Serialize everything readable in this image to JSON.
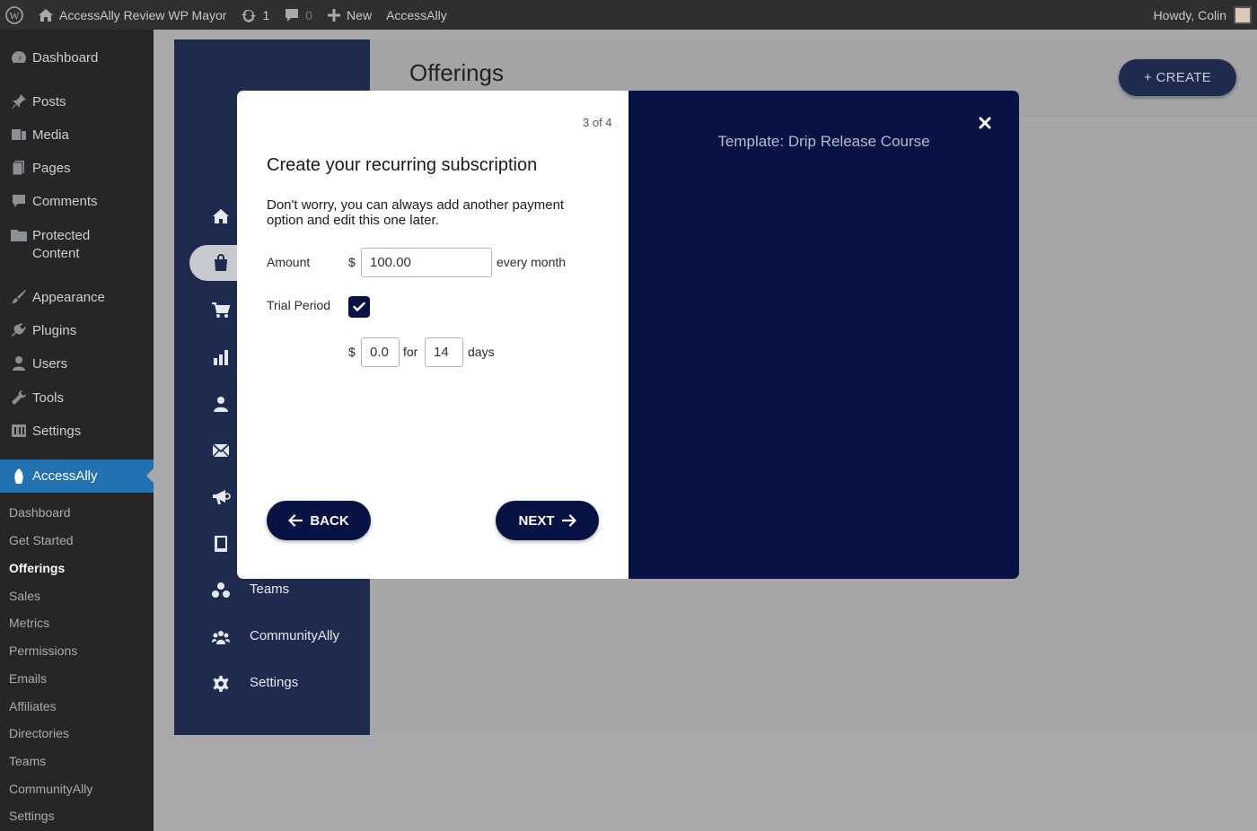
{
  "adminbar": {
    "site_name": "AccessAlly Review WP Mayor",
    "updates_count": "1",
    "comments_count": "0",
    "new_label": "New",
    "plugin_label": "AccessAlly",
    "howdy": "Howdy, Colin"
  },
  "wp_menu": {
    "items": [
      {
        "label": "Dashboard",
        "icon": "dashboard-icon"
      },
      {
        "label": "Posts",
        "icon": "pin-icon"
      },
      {
        "label": "Media",
        "icon": "media-icon"
      },
      {
        "label": "Pages",
        "icon": "pages-icon"
      },
      {
        "label": "Comments",
        "icon": "comment-icon"
      },
      {
        "label": "Protected Content",
        "icon": "folder-icon"
      },
      {
        "label": "Appearance",
        "icon": "brush-icon"
      },
      {
        "label": "Plugins",
        "icon": "plugin-icon"
      },
      {
        "label": "Users",
        "icon": "user-icon"
      },
      {
        "label": "Tools",
        "icon": "wrench-icon"
      },
      {
        "label": "Settings",
        "icon": "settings-icon"
      },
      {
        "label": "AccessAlly",
        "icon": "accessally-icon"
      }
    ],
    "submenu": [
      "Dashboard",
      "Get Started",
      "Offerings",
      "Sales",
      "Metrics",
      "Permissions",
      "Emails",
      "Affiliates",
      "Directories",
      "Teams",
      "CommunityAlly",
      "Settings"
    ],
    "current_submenu": "Offerings"
  },
  "aa_nav": {
    "items": [
      {
        "icon": "home-icon"
      },
      {
        "icon": "shop-bag-icon"
      },
      {
        "icon": "cart-icon"
      },
      {
        "icon": "bar-chart-icon"
      },
      {
        "icon": "person-icon"
      },
      {
        "icon": "envelope-icon"
      },
      {
        "icon": "megaphone-icon"
      },
      {
        "icon": "book-icon"
      },
      {
        "icon": "teams-icon",
        "label": "Teams"
      },
      {
        "icon": "community-icon",
        "label": "CommunityAlly"
      },
      {
        "icon": "gear-icon",
        "label": "Settings"
      }
    ]
  },
  "page": {
    "title": "Offerings",
    "create_label": "+ CREATE"
  },
  "modal": {
    "step": "3 of 4",
    "heading": "Create your recurring subscription",
    "description": "Don't worry, you can always add another payment option and edit this one later.",
    "amount_label": "Amount",
    "currency": "$",
    "amount_value": "100.00",
    "frequency": "every month",
    "trial_label": "Trial Period",
    "trial_checked": true,
    "trial_price": "0.0",
    "trial_for": "for",
    "trial_days_value": "14",
    "trial_days_unit": "days",
    "back_label": "BACK",
    "next_label": "NEXT",
    "template_label": "Template: Drip Release Course"
  },
  "colors": {
    "navy": "#061344",
    "panel": "#1f2a4f",
    "wp_active": "#2271b1"
  }
}
